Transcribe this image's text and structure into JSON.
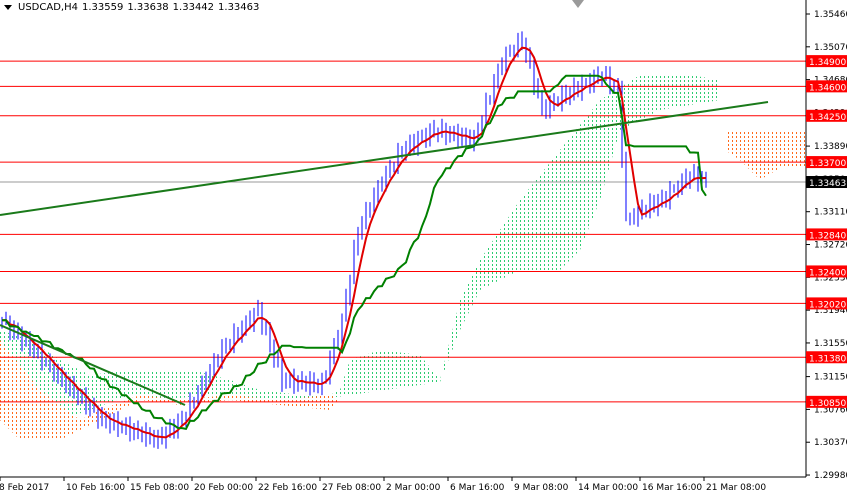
{
  "header": {
    "symbol": "USDCAD,H4",
    "open": "1.33559",
    "high": "1.33638",
    "low": "1.33442",
    "close": "1.33463"
  },
  "colors": {
    "level": "#ff0000",
    "ma_red": "#e00000",
    "ma_green": "#008000",
    "trend": "#1a7a1a",
    "cloud_green": "#2ecc71",
    "cloud_orange": "#ff6a1a",
    "candle": "#0000ff",
    "current": "#000000"
  },
  "chart_data": {
    "type": "candlestick",
    "title": "USDCAD,H4",
    "price_ticks": [
      "1.35460",
      "1.35070",
      "1.34680",
      "1.34290",
      "1.33890",
      "1.33500",
      "1.33110",
      "1.32720",
      "1.32330",
      "1.31940",
      "1.31550",
      "1.31150",
      "1.30760",
      "1.30370",
      "1.29980"
    ],
    "ylim": [
      1.2998,
      1.3546
    ],
    "time_labels": [
      {
        "bar": 0,
        "label": "8 Feb 2017"
      },
      {
        "bar": 16,
        "label": "10 Feb 16:00"
      },
      {
        "bar": 32,
        "label": "15 Feb 08:00"
      },
      {
        "bar": 48,
        "label": "20 Feb 00:00"
      },
      {
        "bar": 64,
        "label": "22 Feb 16:00"
      },
      {
        "bar": 80,
        "label": "27 Feb 08:00"
      },
      {
        "bar": 96,
        "label": "2 Mar 00:00"
      },
      {
        "bar": 112,
        "label": "6 Mar 16:00"
      },
      {
        "bar": 128,
        "label": "9 Mar 08:00"
      },
      {
        "bar": 144,
        "label": "14 Mar 00:00"
      },
      {
        "bar": 160,
        "label": "16 Mar 16:00"
      },
      {
        "bar": 176,
        "label": "21 Mar 08:00"
      }
    ],
    "levels": [
      "1.34900",
      "1.34600",
      "1.34250",
      "1.33700",
      "1.32840",
      "1.32400",
      "1.32020",
      "1.31380",
      "1.30850"
    ],
    "current_price": "1.33463",
    "close_path": [
      [
        0,
        1.3182
      ],
      [
        8,
        1.3147
      ],
      [
        15,
        1.3111
      ],
      [
        25,
        1.3064
      ],
      [
        39,
        1.304
      ],
      [
        45,
        1.3064
      ],
      [
        55,
        1.3147
      ],
      [
        64,
        1.3194
      ],
      [
        70,
        1.3111
      ],
      [
        80,
        1.3105
      ],
      [
        85,
        1.3182
      ],
      [
        89,
        1.3289
      ],
      [
        95,
        1.3349
      ],
      [
        100,
        1.3384
      ],
      [
        108,
        1.3408
      ],
      [
        118,
        1.3396
      ],
      [
        125,
        1.3491
      ],
      [
        130,
        1.3515
      ],
      [
        135,
        1.3432
      ],
      [
        143,
        1.3456
      ],
      [
        150,
        1.3474
      ],
      [
        154,
        1.3456
      ],
      [
        156,
        1.3301
      ],
      [
        160,
        1.3313
      ],
      [
        165,
        1.3325
      ],
      [
        172,
        1.3355
      ],
      [
        176,
        1.3346
      ]
    ]
  }
}
